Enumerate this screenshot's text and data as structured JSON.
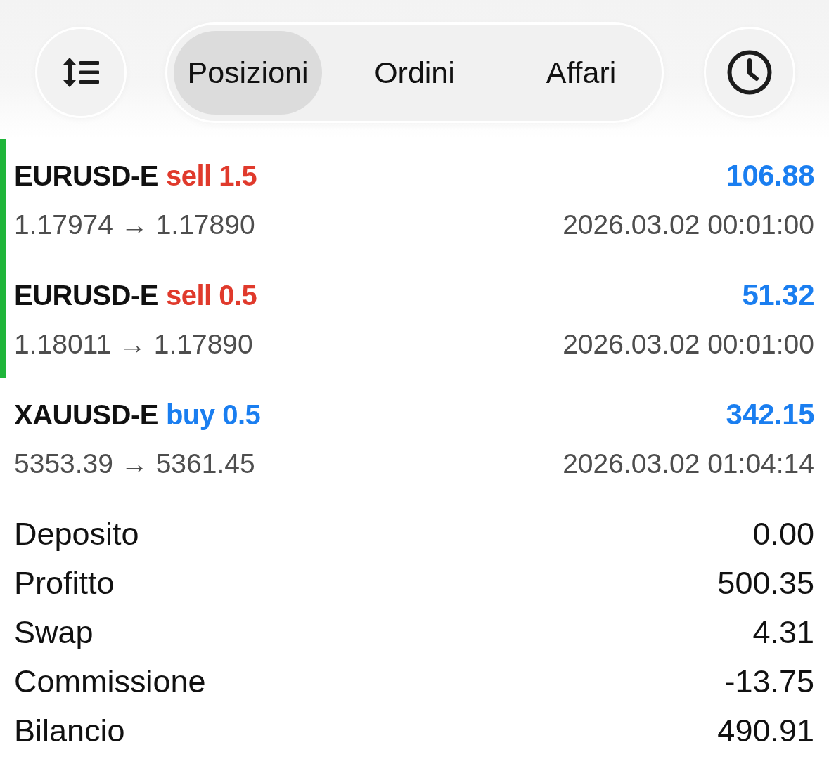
{
  "toolbar": {
    "tabs": [
      {
        "label": "Posizioni",
        "selected": true
      },
      {
        "label": "Ordini",
        "selected": false
      },
      {
        "label": "Affari",
        "selected": false
      }
    ]
  },
  "positions": [
    {
      "symbol": "EURUSD-E",
      "kind": "sell",
      "trade": "sell 1.5",
      "profit": "106.88",
      "prices": "1.17974 → 1.17890",
      "time": "2026.03.02 00:01:00",
      "highlighted": true
    },
    {
      "symbol": "EURUSD-E",
      "kind": "sell",
      "trade": "sell 0.5",
      "profit": "51.32",
      "prices": "1.18011 → 1.17890",
      "time": "2026.03.02 00:01:00",
      "highlighted": true
    },
    {
      "symbol": "XAUUSD-E",
      "kind": "buy",
      "trade": "buy 0.5",
      "profit": "342.15",
      "prices": "5353.39 → 5361.45",
      "time": "2026.03.02 01:04:14",
      "highlighted": false
    }
  ],
  "summary": [
    {
      "label": "Deposito",
      "value": "0.00"
    },
    {
      "label": "Profitto",
      "value": "500.35"
    },
    {
      "label": "Swap",
      "value": "4.31"
    },
    {
      "label": "Commissione",
      "value": "-13.75"
    },
    {
      "label": "Bilancio",
      "value": "490.91"
    }
  ]
}
